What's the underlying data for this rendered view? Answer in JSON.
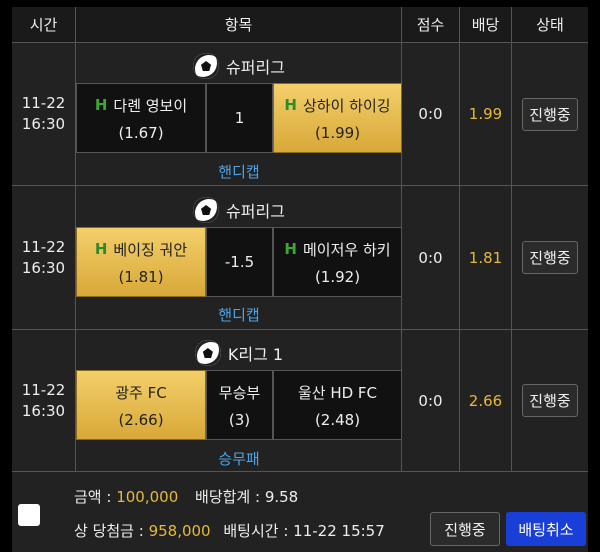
{
  "header": {
    "time": "시간",
    "item": "항목",
    "score": "점수",
    "odds": "배당",
    "status": "상태"
  },
  "rows": [
    {
      "date": "11-22",
      "clock": "16:30",
      "league": "슈퍼리그",
      "home": {
        "name": "다롄 영보이",
        "odds": "(1.67)",
        "mark": "H"
      },
      "mid": "1",
      "away": {
        "name": "상하이 하이깅",
        "odds": "(1.99)",
        "mark": "H"
      },
      "market": "핸디캡",
      "score": "0:0",
      "bet_odds": "1.99",
      "status": "진행중"
    },
    {
      "date": "11-22",
      "clock": "16:30",
      "league": "슈퍼리그",
      "home": {
        "name": "베이징 궈안",
        "odds": "(1.81)",
        "mark": "H"
      },
      "mid": "-1.5",
      "away": {
        "name": "메이저우 하키",
        "odds": "(1.92)",
        "mark": "H"
      },
      "market": "핸디캡",
      "score": "0:0",
      "bet_odds": "1.81",
      "status": "진행중"
    },
    {
      "date": "11-22",
      "clock": "16:30",
      "league": "K리그 1",
      "home": {
        "name": "광주 FC",
        "odds": "(2.66)"
      },
      "mid_label": "무승부",
      "mid_odds": "(3)",
      "away": {
        "name": "울산 HD FC",
        "odds": "(2.48)"
      },
      "market": "승무패",
      "score": "0:0",
      "bet_odds": "2.66",
      "status": "진행중"
    }
  ],
  "footer": {
    "amount_label": "금액 : ",
    "amount": "100,000",
    "total_odds_label": "배당합계 : ",
    "total_odds": "9.58",
    "win_label": "상 당첨금 : ",
    "win": "958,000",
    "time_label": "배팅시간 : ",
    "time": "11-22 15:57",
    "status_button": "진행중",
    "cancel_button": "배팅취소"
  },
  "colors": {
    "selected": "#e6b93a",
    "market": "#4aa3e8",
    "cancel": "#1a3fd6",
    "handicap_mark": "#3aa832"
  }
}
